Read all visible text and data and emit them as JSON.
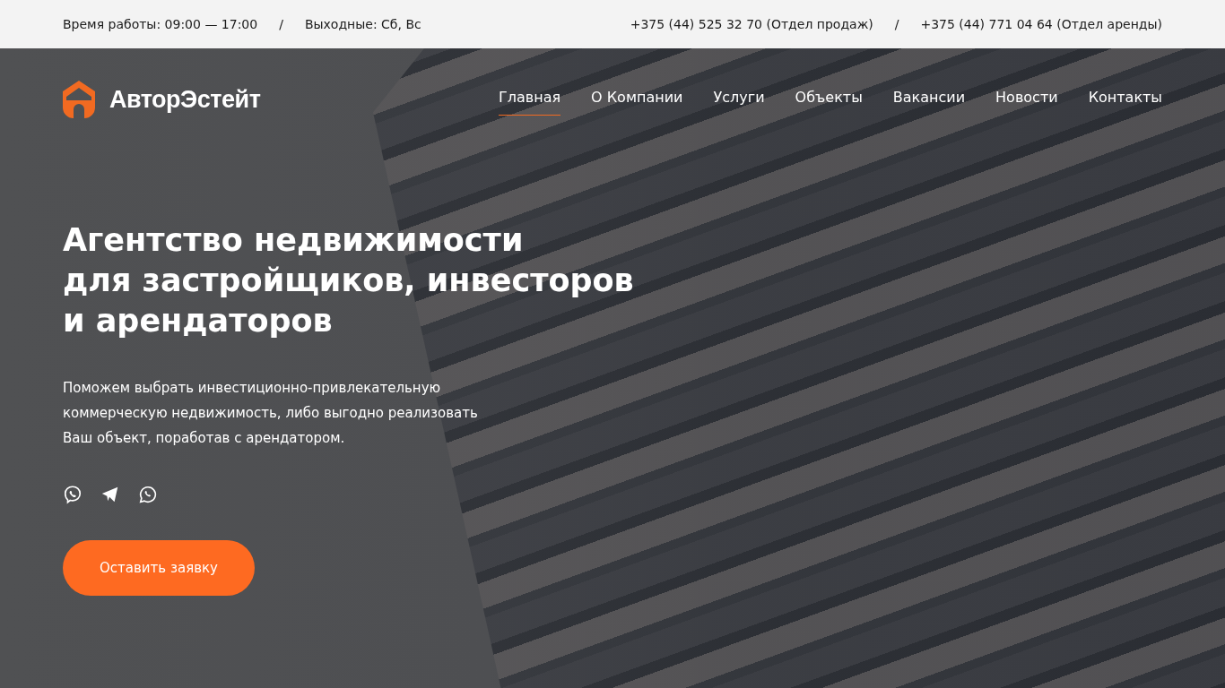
{
  "top_bar": {
    "hours": "Время работы: 09:00 — 17:00",
    "separator_1": "/",
    "weekends": "Выходные: Сб, Вс",
    "phone_sales": "+375 (44) 525 32 70 (Отдел продаж)",
    "separator_2": "/",
    "phone_rent": "+375 (44) 771 04 64 (Отдел аренды)"
  },
  "logo": {
    "text": "АвторЭстейт"
  },
  "nav": [
    {
      "label": "Главная",
      "selected": true
    },
    {
      "label": "О Компании",
      "selected": false
    },
    {
      "label": "Услуги",
      "selected": false
    },
    {
      "label": "Объекты",
      "selected": false
    },
    {
      "label": "Вакансии",
      "selected": false
    },
    {
      "label": "Новости",
      "selected": false
    },
    {
      "label": "Контакты",
      "selected": false
    }
  ],
  "hero": {
    "title_lines": [
      "Агентство недвижимости",
      "для застройщиков, инвесторов",
      "и арендаторов"
    ],
    "description_lines": [
      "Поможем выбрать инвестиционно-привлекательную",
      "коммерческую недвижимость, либо выгодно реализовать",
      "Ваш объект, поработав с арендатором."
    ],
    "button": "Оставить заявку"
  }
}
